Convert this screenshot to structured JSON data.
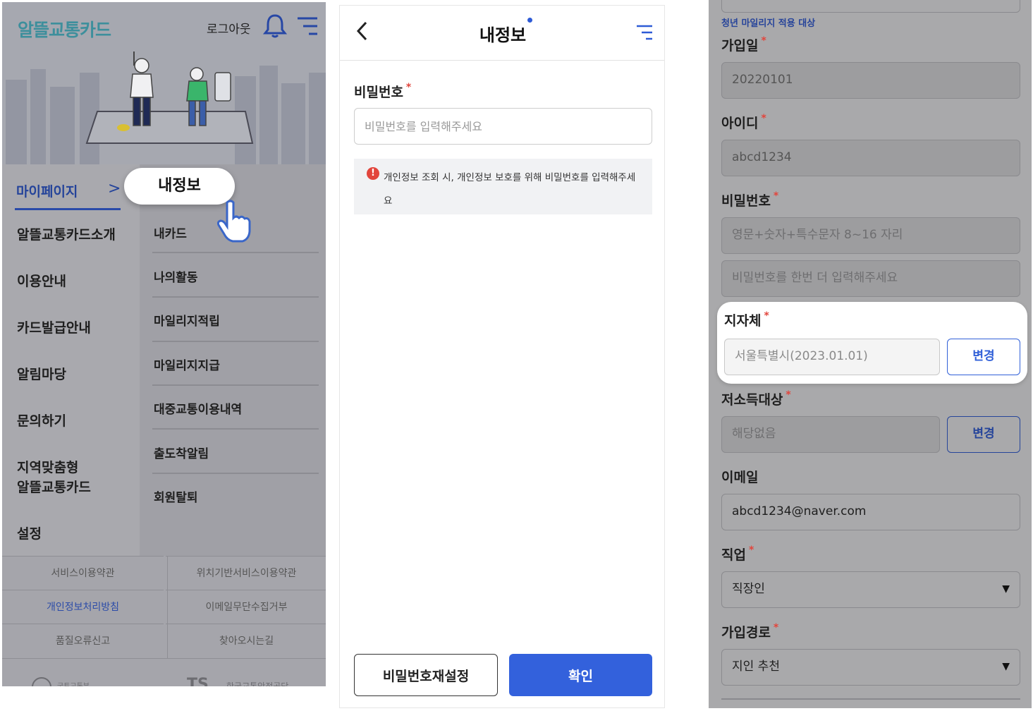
{
  "screen1": {
    "logo": "알뜰교통카드",
    "logout": "로그아웃",
    "mypage": "마이페이지",
    "mypage_arrow": ">",
    "popup": "내정보",
    "left_menu": [
      "알뜰교통카드소개",
      "이용안내",
      "카드발급안내",
      "알림마당",
      "문의하기",
      "지역맞춤형\n알뜰교통카드",
      "설정"
    ],
    "right_menu": [
      "내카드",
      "나의활동",
      "마일리지적립",
      "마일리지지급",
      "대중교통이용내역",
      "출도착알림",
      "회원탈퇴"
    ],
    "footer_links": [
      "서비스이용약관",
      "위치기반서비스이용약관",
      "개인정보처리방침",
      "이메일무단수집거부",
      "품질오류신고",
      "찾아오시는길"
    ],
    "footer_logos": [
      "국토교통부",
      "한국교통안전공단"
    ],
    "colors": {
      "accent": "#24439a",
      "logo": "#3d8f9c"
    }
  },
  "screen2": {
    "title": "내정보",
    "password_label": "비밀번호",
    "password_placeholder": "비밀번호를 입력해주세요",
    "notice": "개인정보 조회 시, 개인정보 보호를 위해 비밀번호를 입력해주세요",
    "reset_button": "비밀번호재설정",
    "confirm_button": "확인",
    "colors": {
      "primary": "#3361dc",
      "required": "#e2453c"
    }
  },
  "screen3": {
    "target_note": "청년 마일리지 적용 대상",
    "join_date_label": "가입일",
    "join_date": "20220101",
    "id_label": "아이디",
    "id": "abcd1234",
    "password_label": "비밀번호",
    "password_placeholder": "영문+숫자+특수문자 8~16 자리",
    "password_confirm_placeholder": "비밀번호를 한번 더 입력해주세요",
    "region_label": "지자체",
    "region_value": "서울특별시(2023.01.01)",
    "change_button": "변경",
    "low_income_label": "저소득대상",
    "low_income_value": "해당없음",
    "email_label": "이메일",
    "email": "abcd1234@naver.com",
    "job_label": "직업",
    "job_value": "직장인",
    "signup_route_label": "가입경로",
    "signup_route_value": "지인 추천",
    "required_mark": "*"
  }
}
